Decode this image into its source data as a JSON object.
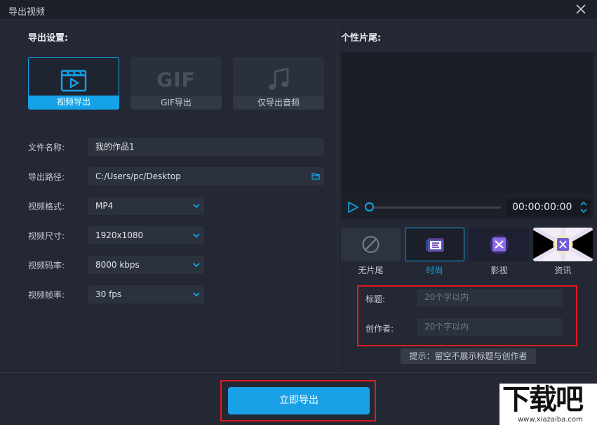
{
  "window": {
    "title": "导出视频"
  },
  "left": {
    "section_title": "导出设置:",
    "modes": [
      {
        "label": "视频导出",
        "icon": "video-clapper-icon",
        "active": true
      },
      {
        "label": "GIF导出",
        "icon": "gif-icon",
        "icon_text": "GIF",
        "active": false
      },
      {
        "label": "仅导出音频",
        "icon": "music-note-icon",
        "active": false
      }
    ],
    "fields": {
      "filename": {
        "label": "文件名称:",
        "value": "我的作品1"
      },
      "path": {
        "label": "导出路径:",
        "value": "C:/Users/pc/Desktop"
      },
      "format": {
        "label": "视频格式:",
        "value": "MP4"
      },
      "size": {
        "label": "视频尺寸:",
        "value": "1920x1080"
      },
      "bitrate": {
        "label": "视频码率:",
        "value": "8000 kbps"
      },
      "framerate": {
        "label": "视频帧率:",
        "value": "30 fps"
      }
    }
  },
  "right": {
    "section_title": "个性片尾:",
    "player": {
      "time": "00:00:00:00",
      "progress": 0
    },
    "templates": [
      {
        "label": "无片尾",
        "icon": "none-circle-icon",
        "active": false
      },
      {
        "label": "时尚",
        "icon": "fashion-thumb",
        "active": true
      },
      {
        "label": "影视",
        "icon": "film-thumb",
        "active": false
      },
      {
        "label": "资讯",
        "icon": "news-thumb",
        "active": false
      }
    ],
    "title_field": {
      "label": "标题:",
      "placeholder": "20个字以内"
    },
    "author_field": {
      "label": "创作者:",
      "placeholder": "20个字以内"
    },
    "hint": "提示：留空不展示标题与创作者"
  },
  "footer": {
    "export_label": "立即导出"
  },
  "watermark": {
    "text": "下载吧",
    "url": "www.xiazaiba.com"
  },
  "colors": {
    "accent": "#14a3e8",
    "highlight_red": "#e01b22",
    "bg": "#232834"
  }
}
